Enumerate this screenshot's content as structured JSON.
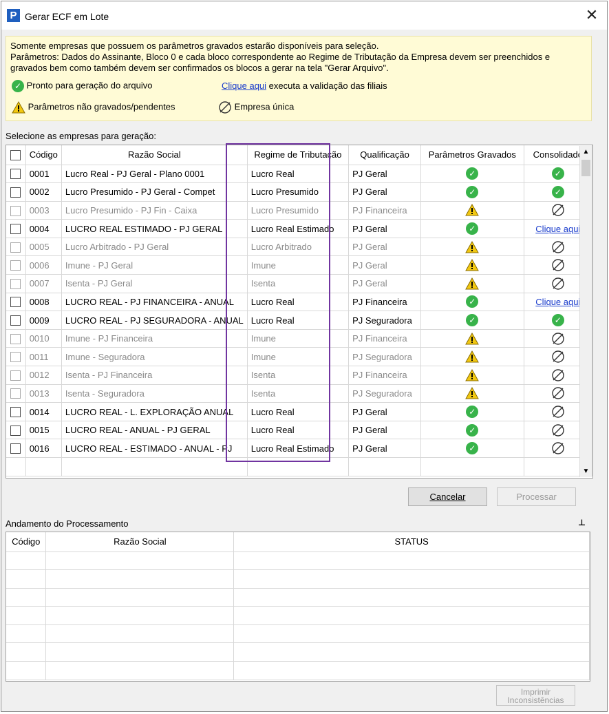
{
  "window": {
    "title": "Gerar ECF em Lote",
    "app_icon": "P",
    "close": "✕"
  },
  "info": {
    "line1": "Somente empresas que possuem os parâmetros gravados estarão disponíveis para seleção.",
    "line2": "Parâmetros: Dados do Assinante, Bloco 0 e cada bloco correspondente ao Regime de Tributação da Empresa devem  ser preenchidos e",
    "line3": "gravados bem como também devem ser confirmados os blocos a gerar na tela \"Gerar Arquivo\".",
    "legend_ok": "Pronto para geração do arquivo",
    "legend_link": "Clique aqui",
    "legend_link_text": "executa a validação das filiais",
    "legend_warn": "Parâmetros não gravados/pendentes",
    "legend_single": "Empresa única"
  },
  "select_label": "Selecione as empresas para geração:",
  "companies": {
    "headers": [
      "Código",
      "Razão Social",
      "Regime de Tributação",
      "Qualificação",
      "Parâmetros Gravados",
      "Consolidado"
    ],
    "rows": [
      {
        "codigo": "0001",
        "razao": "Lucro Real - PJ Geral - Plano 0001",
        "regime": "Lucro Real",
        "qualif": "PJ Geral",
        "param": "ok",
        "consol": "ok",
        "dim": false
      },
      {
        "codigo": "0002",
        "razao": "Lucro Presumido - PJ Geral - Compet",
        "regime": "Lucro Presumido",
        "qualif": "PJ Geral",
        "param": "ok",
        "consol": "ok",
        "dim": false
      },
      {
        "codigo": "0003",
        "razao": "Lucro Presumido - PJ Fin - Caixa",
        "regime": "Lucro Presumido",
        "qualif": "PJ Financeira",
        "param": "warn",
        "consol": "single",
        "dim": true
      },
      {
        "codigo": "0004",
        "razao": "LUCRO REAL ESTIMADO - PJ GERAL",
        "regime": "Lucro Real Estimado",
        "qualif": "PJ Geral",
        "param": "ok",
        "consol": "link",
        "dim": false
      },
      {
        "codigo": "0005",
        "razao": "Lucro Arbitrado - PJ Geral",
        "regime": "Lucro Arbitrado",
        "qualif": "PJ Geral",
        "param": "warn",
        "consol": "single",
        "dim": true
      },
      {
        "codigo": "0006",
        "razao": "Imune - PJ Geral",
        "regime": "Imune",
        "qualif": "PJ Geral",
        "param": "warn",
        "consol": "single",
        "dim": true
      },
      {
        "codigo": "0007",
        "razao": "Isenta - PJ Geral",
        "regime": "Isenta",
        "qualif": "PJ Geral",
        "param": "warn",
        "consol": "single",
        "dim": true
      },
      {
        "codigo": "0008",
        "razao": "LUCRO REAL - PJ FINANCEIRA - ANUAL",
        "regime": "Lucro Real",
        "qualif": "PJ Financeira",
        "param": "ok",
        "consol": "link",
        "dim": false
      },
      {
        "codigo": "0009",
        "razao": "LUCRO REAL - PJ SEGURADORA - ANUAL",
        "regime": "Lucro Real",
        "qualif": "PJ Seguradora",
        "param": "ok",
        "consol": "ok",
        "dim": false
      },
      {
        "codigo": "0010",
        "razao": "Imune - PJ Financeira",
        "regime": "Imune",
        "qualif": "PJ Financeira",
        "param": "warn",
        "consol": "single",
        "dim": true
      },
      {
        "codigo": "0011",
        "razao": "Imune - Seguradora",
        "regime": "Imune",
        "qualif": "PJ Seguradora",
        "param": "warn",
        "consol": "single",
        "dim": true
      },
      {
        "codigo": "0012",
        "razao": "Isenta - PJ Financeira",
        "regime": "Isenta",
        "qualif": "PJ Financeira",
        "param": "warn",
        "consol": "single",
        "dim": true
      },
      {
        "codigo": "0013",
        "razao": "Isenta - Seguradora",
        "regime": "Isenta",
        "qualif": "PJ Seguradora",
        "param": "warn",
        "consol": "single",
        "dim": true
      },
      {
        "codigo": "0014",
        "razao": "LUCRO REAL - L. EXPLORAÇÃO ANUAL",
        "regime": "Lucro Real",
        "qualif": "PJ Geral",
        "param": "ok",
        "consol": "single",
        "dim": false
      },
      {
        "codigo": "0015",
        "razao": "LUCRO REAL - ANUAL - PJ GERAL",
        "regime": "Lucro Real",
        "qualif": "PJ Geral",
        "param": "ok",
        "consol": "single",
        "dim": false
      },
      {
        "codigo": "0016",
        "razao": "LUCRO REAL - ESTIMADO - ANUAL - PJ",
        "regime": "Lucro Real Estimado",
        "qualif": "PJ Geral",
        "param": "ok",
        "consol": "single",
        "dim": false
      }
    ],
    "link_text": "Clique aqui"
  },
  "buttons": {
    "cancel": "Cancelar",
    "process": "Processar",
    "print_line1": "Imprimir",
    "print_line2": "Inconsistências"
  },
  "processing": {
    "title": "Andamento do Processamento",
    "headers": [
      "Código",
      "Razão Social",
      "STATUS"
    ]
  },
  "colors": {
    "ok": "#38b34a",
    "warn": "#f2c811",
    "highlight": "#7034a0",
    "link": "#1a3ccc",
    "info_bg": "#fffbd6"
  },
  "icons": {
    "ok": "check-circle-icon",
    "warn": "warning-triangle-icon",
    "single": "empty-set-icon",
    "pin": "pin-icon"
  }
}
